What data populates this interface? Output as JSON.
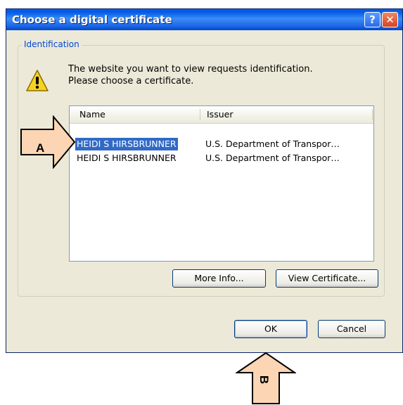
{
  "window": {
    "title": "Choose a digital certificate",
    "help_glyph": "?",
    "close_glyph": "✕"
  },
  "group": {
    "label": "Identification"
  },
  "message": {
    "line1": "The website you want to view requests identification.",
    "line2": "Please choose a certificate."
  },
  "list": {
    "columns": [
      "Name",
      "Issuer"
    ],
    "rows": [
      {
        "name": "HEIDI S HIRSBRUNNER",
        "issuer": "U.S. Department of Transpor…",
        "selected": true
      },
      {
        "name": "HEIDI S HIRSBRUNNER",
        "issuer": "U.S. Department of Transpor…",
        "selected": false
      }
    ]
  },
  "buttons": {
    "more_info": "More Info...",
    "view_certificate": "View Certificate...",
    "ok": "OK",
    "cancel": "Cancel"
  },
  "annotations": {
    "a_label": "A",
    "b_label": "B",
    "fill": "#fcd5b4"
  },
  "icons": {
    "warning": "warning-icon",
    "help": "help-icon",
    "close": "close-icon"
  }
}
